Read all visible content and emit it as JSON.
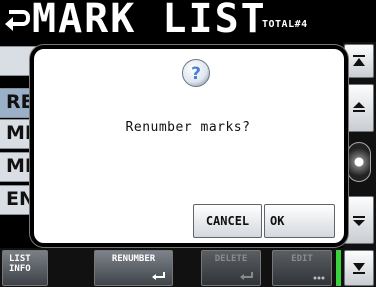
{
  "header": {
    "title": "MARK LIST",
    "total": "TOTAL#4"
  },
  "list": {
    "rows": [
      "RE",
      "MF",
      "MF",
      "EN"
    ]
  },
  "function_bar": {
    "list_info": "LIST\nINFO",
    "renumber": "RENUMBER",
    "delete": "DELETE",
    "edit": "EDIT"
  },
  "dialog": {
    "message": "Renumber marks?",
    "cancel_label": "CANCEL",
    "ok_label": "OK"
  },
  "icons": {
    "back": "return-arrow-icon",
    "question": "question-icon",
    "scroll_top": "jump-to-top-icon",
    "scroll_up": "scroll-up-icon",
    "scroll_down": "scroll-down-icon",
    "scroll_bottom": "jump-to-bottom-icon"
  },
  "colors": {
    "accent_green": "#3bd13b",
    "question_blue": "#4a7fd6"
  }
}
